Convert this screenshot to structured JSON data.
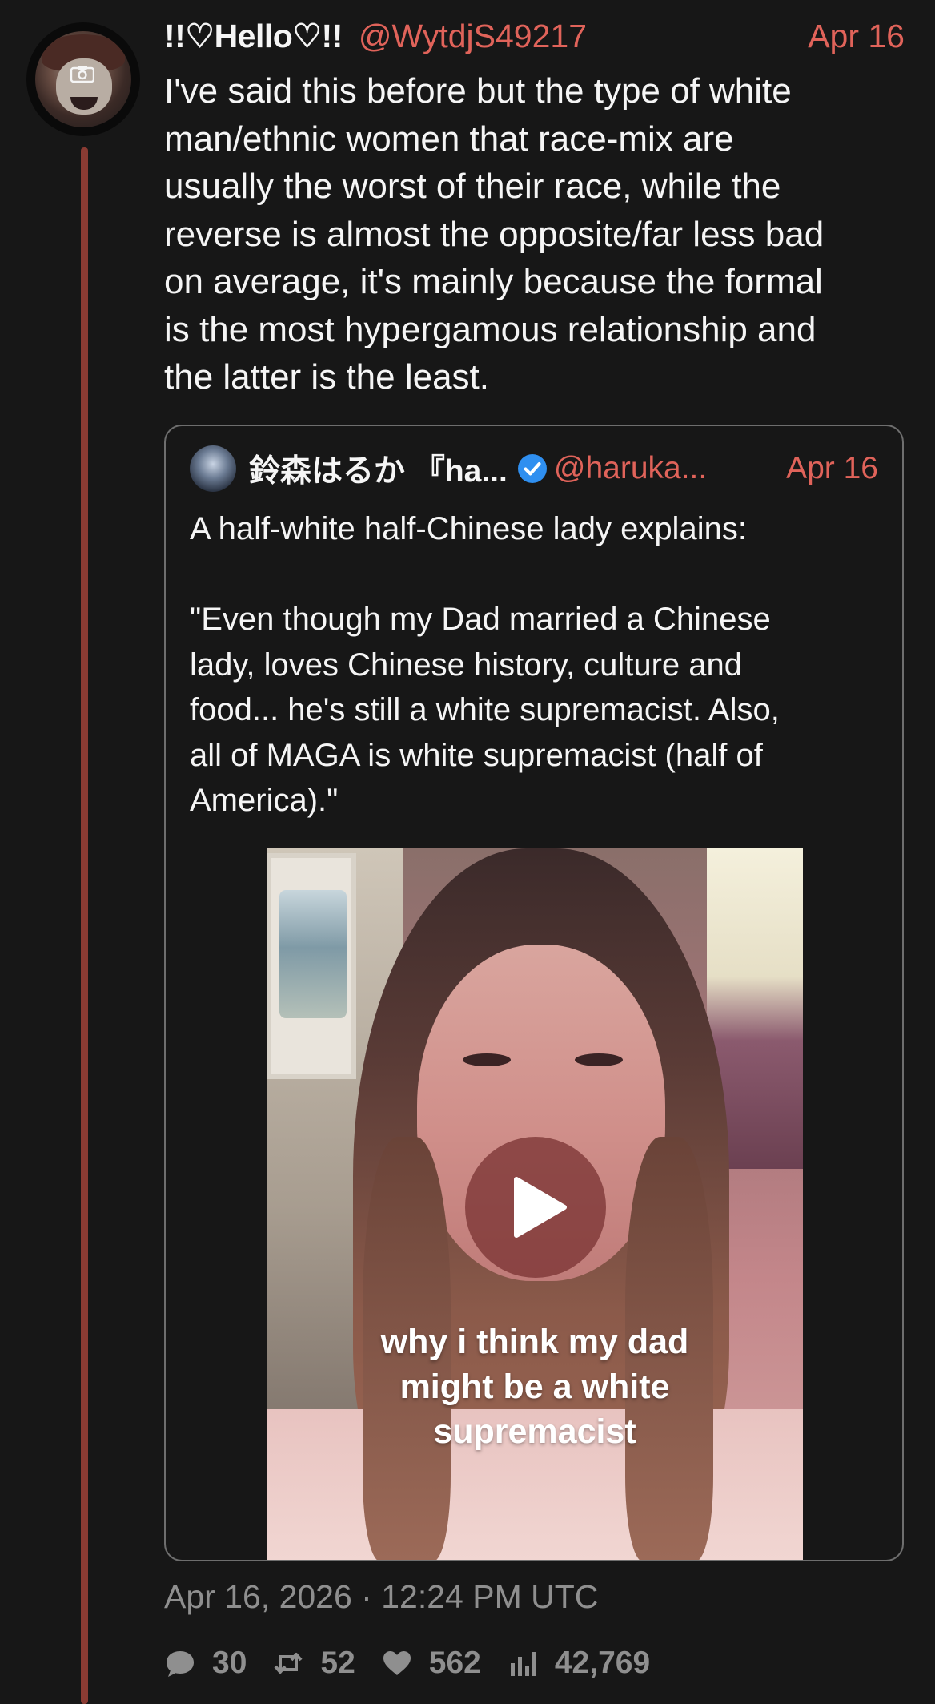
{
  "tweet": {
    "display_name": "!!♡Hello♡!!",
    "handle": "@WytdjS49217",
    "date": "Apr 16",
    "text": "I've said this before but the type of white\nman/ethnic women that race-mix are\nusually the worst of their race, while the\nreverse is almost the opposite/far less bad\non average, it's mainly because the formal\nis the most hypergamous relationship and\nthe latter is the least."
  },
  "quote": {
    "display_name": "鈴森はるか 『ha...",
    "handle": "@haruka...",
    "date": "Apr 16",
    "verified_icon": "verified-check-icon",
    "text": "A half-white half-Chinese lady explains:\n\n\"Even though my Dad married a Chinese\nlady, loves Chinese history, culture and\nfood... he's still a white supremacist. Also,\nall of MAGA is white supremacist (half of\nAmerica).\"",
    "video": {
      "caption": "why i think my dad\nmight be a white\nsupremacist",
      "play_icon": "play-icon"
    }
  },
  "meta": {
    "timestamp": "Apr 16, 2026 · 12:24 PM UTC"
  },
  "actions": {
    "replies": "30",
    "retweets": "52",
    "likes": "562",
    "views": "42,769"
  },
  "colors": {
    "accent": "#e0635a",
    "background": "#171717",
    "thread_line": "#8a3b33",
    "muted_text": "#8f8f8f"
  }
}
